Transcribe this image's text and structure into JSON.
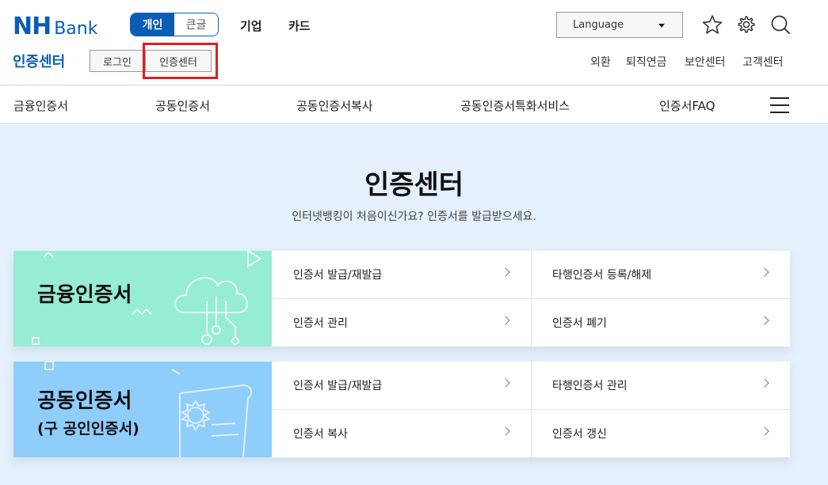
{
  "header": {
    "logo_main": "NH",
    "logo_sub": "Bank",
    "segments": [
      "개인",
      "큰글"
    ],
    "top_nav": [
      "기업",
      "카드"
    ],
    "language_label": "Language",
    "section_title": "인증센터",
    "sub_buttons": [
      "로그인",
      "인증센터"
    ],
    "util_links": [
      "외환",
      "퇴직연금",
      "보안센터",
      "고객센터"
    ]
  },
  "nav": {
    "items": [
      "금융인증서",
      "공동인증서",
      "공동인증서복사",
      "공동인증서특화서비스",
      "인증서FAQ"
    ]
  },
  "main": {
    "title": "인증센터",
    "subtitle": "인터넷뱅킹이 처음이신가요? 인증서를 발급받으세요."
  },
  "cards": [
    {
      "name": "금융인증서",
      "name_sub": "",
      "accent": "#97ecd4",
      "links": [
        "인증서 발급/재발급",
        "타행인증서 등록/해제",
        "인증서 관리",
        "인증서 폐기"
      ]
    },
    {
      "name": "공동인증서",
      "name_sub": "(구 공인인증서)",
      "accent": "#8fcdfb",
      "links": [
        "인증서 발급/재발급",
        "타행인증서 관리",
        "인증서 복사",
        "인증서 갱신"
      ]
    }
  ],
  "colors": {
    "brand": "#0b5db3",
    "highlight": "#e01e1e",
    "background": "#e4f0fb"
  },
  "icons": [
    "star-icon",
    "gear-icon",
    "search-icon",
    "menu-icon",
    "chevron-right-icon",
    "cloud-icon",
    "certificate-icon"
  ]
}
